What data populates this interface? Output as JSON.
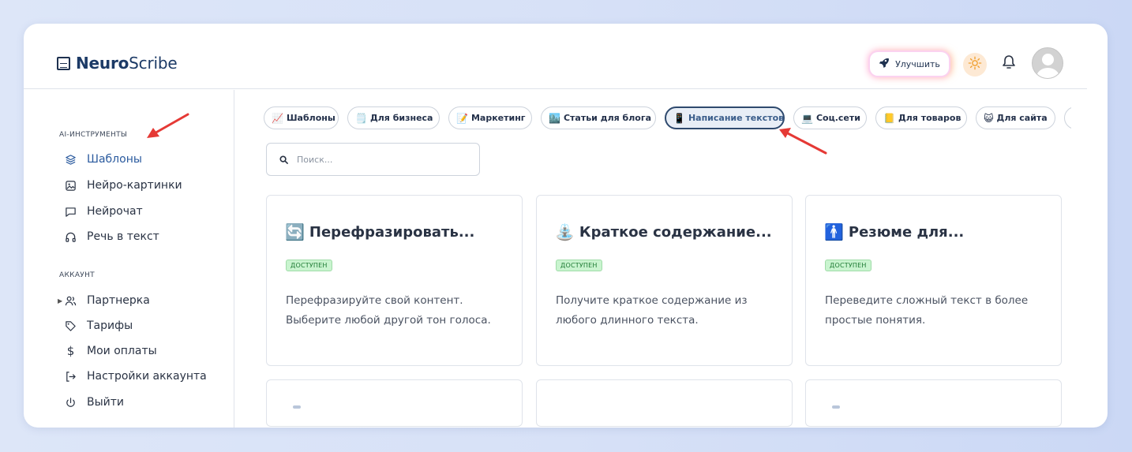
{
  "header": {
    "logo_bold": "Neuro",
    "logo_regular": "Scribe",
    "upgrade_label": "Улучшить"
  },
  "sidebar": {
    "section_tools": "AI-ИНСТРУМЕНТЫ",
    "tools": [
      {
        "label": "Шаблоны",
        "icon": "layers-icon"
      },
      {
        "label": "Нейро-картинки",
        "icon": "image-icon"
      },
      {
        "label": "Нейрочат",
        "icon": "chat-icon"
      },
      {
        "label": "Речь в текст",
        "icon": "headphones-icon"
      }
    ],
    "section_account": "АККАУНТ",
    "account": [
      {
        "label": "Партнерка",
        "icon": "users-icon"
      },
      {
        "label": "Тарифы",
        "icon": "tag-icon"
      },
      {
        "label": "Мои оплаты",
        "icon": "dollar-icon"
      },
      {
        "label": "Настройки аккаунта",
        "icon": "login-icon"
      },
      {
        "label": "Выйти",
        "icon": "power-icon"
      }
    ]
  },
  "categories": [
    {
      "emoji": "📈",
      "label": "Шаблоны"
    },
    {
      "emoji": "🗒️",
      "label": "Для бизнеса"
    },
    {
      "emoji": "📝",
      "label": "Маркетинг"
    },
    {
      "emoji": "🏙️",
      "label": "Статьи для блога"
    },
    {
      "emoji": "📱",
      "label": "Написание текстов"
    },
    {
      "emoji": "💻",
      "label": "Соц.сети"
    },
    {
      "emoji": "📒",
      "label": "Для товаров"
    },
    {
      "emoji": "😺",
      "label": "Для сайта"
    }
  ],
  "active_category": "Написание текстов",
  "search": {
    "placeholder": "Поиск..."
  },
  "cards": [
    {
      "emoji": "🔄",
      "title": "Перефразировать...",
      "badge": "ДОСТУПЕН",
      "description": "Перефразируйте свой контент. Выберите любой другой тон голоса."
    },
    {
      "emoji": "⛲",
      "title": "Краткое содержание...",
      "badge": "ДОСТУПЕН",
      "description": "Получите краткое содержание из любого длинного текста."
    },
    {
      "emoji": "🚹",
      "title": "Резюме для...",
      "badge": "ДОСТУПЕН",
      "description": "Переведите сложный текст в более простые понятия."
    }
  ],
  "colors": {
    "accent": "#2f4a6e",
    "badge_bg": "#c9f4cf",
    "badge_text": "#1d7a33",
    "annotation_arrow": "#e53935"
  }
}
